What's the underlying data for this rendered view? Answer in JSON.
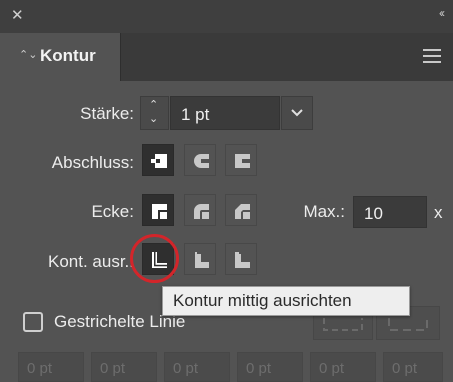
{
  "panel": {
    "close_symbol": "✕",
    "collapse_symbol": "‹‹",
    "tab_title": "Kontur",
    "tab_arrows": "⌃⌄"
  },
  "stroke": {
    "weight_label": "Stärke:",
    "weight_value": "1 pt",
    "stepper_up": "⌃",
    "stepper_down": "⌄",
    "dropdown_symbol": "⌄"
  },
  "cap": {
    "label": "Abschluss:",
    "options": [
      "butt-cap-icon",
      "round-cap-icon",
      "projecting-cap-icon"
    ],
    "selected": 0
  },
  "corner": {
    "label": "Ecke:",
    "options": [
      "miter-join-icon",
      "round-join-icon",
      "bevel-join-icon"
    ],
    "selected": 0,
    "limit_label": "Max.:",
    "limit_value": "10",
    "limit_unit": "x"
  },
  "align": {
    "label": "Kont. ausr.:",
    "options": [
      "align-center-icon",
      "align-inside-icon",
      "align-outside-icon"
    ],
    "selected": 0,
    "highlight_color": "#d3252a"
  },
  "tooltip": {
    "text": "Kontur mittig ausrichten"
  },
  "dashed": {
    "label": "Gestrichelte Linie",
    "checked": false,
    "fields": [
      "0 pt",
      "0 pt",
      "0 pt",
      "0 pt",
      "0 pt",
      "0 pt"
    ]
  }
}
